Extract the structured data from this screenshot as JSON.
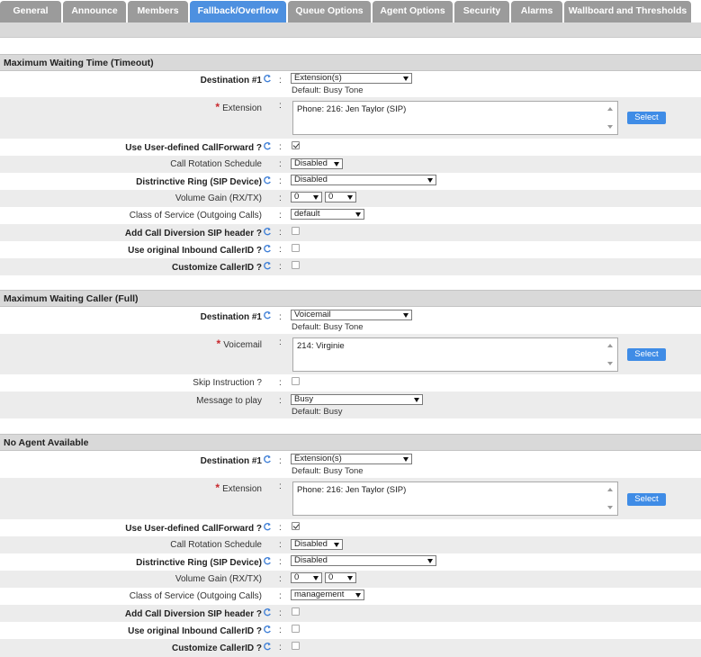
{
  "tabs": [
    {
      "label": "General",
      "active": false
    },
    {
      "label": "Announce",
      "active": false
    },
    {
      "label": "Members",
      "active": false
    },
    {
      "label": "Fallback/Overflow",
      "active": true
    },
    {
      "label": "Queue Options",
      "active": false
    },
    {
      "label": "Agent Options",
      "active": false
    },
    {
      "label": "Security",
      "active": false
    },
    {
      "label": "Alarms",
      "active": false
    },
    {
      "label": "Wallboard and Thresholds",
      "active": false
    }
  ],
  "colors": {
    "active_tab": "#4d90e0",
    "tab": "#9b9b9b",
    "button": "#3f8ce6",
    "required_star": "#c8282d"
  },
  "icons": {
    "refresh": "refresh-icon",
    "dropdown": "chevron-down-icon"
  },
  "timeout": {
    "title": "Maximum Waiting Time (Timeout)",
    "destination_label": "Destination #1",
    "destination_value": "Extension(s)",
    "destination_default": "Default: Busy Tone",
    "extension_label": "Extension",
    "extension_value": "Phone: 216: Jen Taylor (SIP)",
    "select_label": "Select",
    "use_callforward_label": "Use User-defined CallForward ?",
    "use_callforward_checked": true,
    "rotation_label": "Call Rotation Schedule",
    "rotation_value": "Disabled",
    "ring_label": "Distrinctive Ring (SIP Device)",
    "ring_value": "Disabled",
    "gain_label": "Volume Gain (RX/TX)",
    "gain_rx": "0",
    "gain_tx": "0",
    "cos_label": "Class of Service (Outgoing Calls)",
    "cos_value": "default",
    "diversion_label": "Add Call Diversion SIP header ?",
    "diversion_checked": false,
    "original_cid_label": "Use original Inbound CallerID ?",
    "original_cid_checked": false,
    "customize_cid_label": "Customize CallerID ?",
    "customize_cid_checked": false
  },
  "full": {
    "title": "Maximum Waiting Caller (Full)",
    "destination_label": "Destination #1",
    "destination_value": "Voicemail",
    "destination_default": "Default: Busy Tone",
    "voicemail_label": "Voicemail",
    "voicemail_value": "214: Virginie",
    "select_label": "Select",
    "skip_label": "Skip Instruction ?",
    "skip_checked": false,
    "message_label": "Message to play",
    "message_value": "Busy",
    "message_default": "Default: Busy"
  },
  "noagent": {
    "title": "No Agent Available",
    "destination_label": "Destination #1",
    "destination_value": "Extension(s)",
    "destination_default": "Default: Busy Tone",
    "extension_label": "Extension",
    "extension_value": "Phone: 216: Jen Taylor (SIP)",
    "select_label": "Select",
    "use_callforward_label": "Use User-defined CallForward ?",
    "use_callforward_checked": true,
    "rotation_label": "Call Rotation Schedule",
    "rotation_value": "Disabled",
    "ring_label": "Distrinctive Ring (SIP Device)",
    "ring_value": "Disabled",
    "gain_label": "Volume Gain (RX/TX)",
    "gain_rx": "0",
    "gain_tx": "0",
    "cos_label": "Class of Service (Outgoing Calls)",
    "cos_value": "management",
    "diversion_label": "Add Call Diversion SIP header ?",
    "diversion_checked": false,
    "original_cid_label": "Use original Inbound CallerID ?",
    "original_cid_checked": false,
    "customize_cid_label": "Customize CallerID ?",
    "customize_cid_checked": false
  }
}
